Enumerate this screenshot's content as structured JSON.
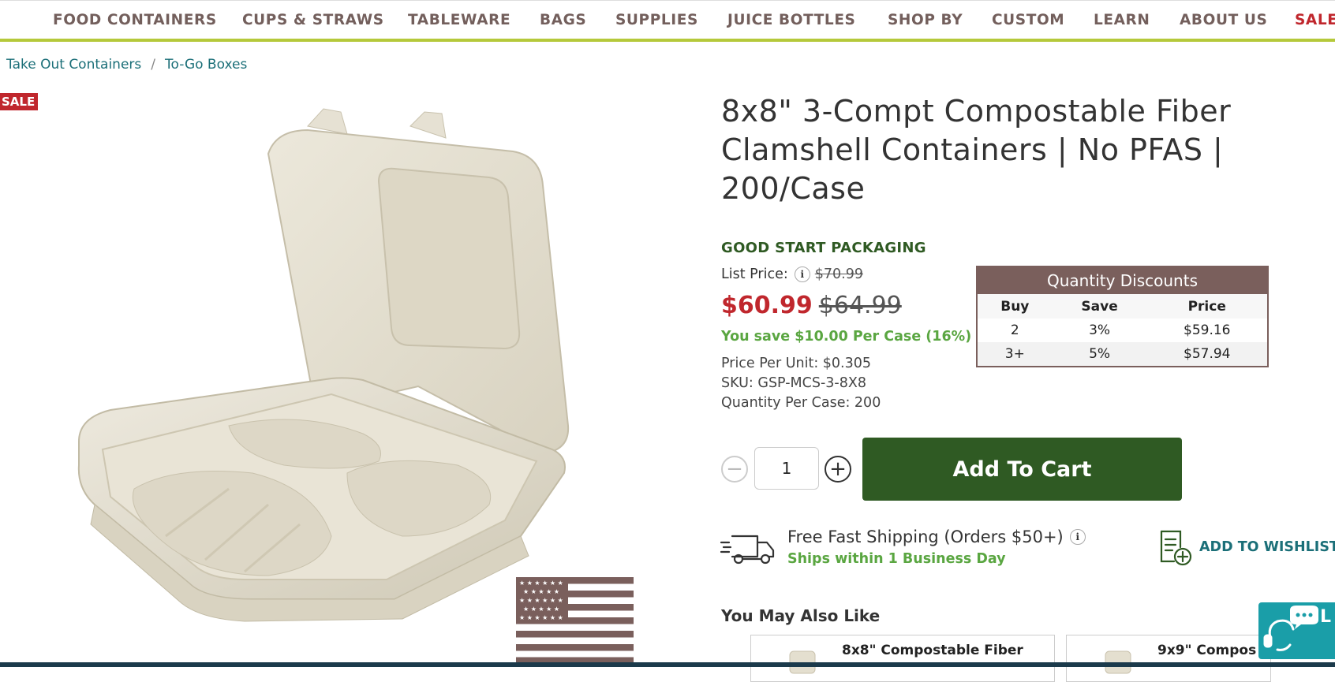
{
  "nav": {
    "items": [
      "FOOD CONTAINERS",
      "CUPS & STRAWS",
      "TABLEWARE",
      "BAGS",
      "SUPPLIES",
      "JUICE BOTTLES",
      "SHOP BY",
      "CUSTOM",
      "LEARN",
      "ABOUT US",
      "SALE"
    ]
  },
  "breadcrumb": {
    "items": [
      "Take Out Containers",
      "To-Go Boxes"
    ],
    "separator": "/"
  },
  "badge": {
    "sale": "SALE"
  },
  "product": {
    "title": "8x8\" 3-Compt Compostable Fiber Clamshell Containers | No PFAS | 200/Case",
    "brand": "GOOD START PACKAGING",
    "list_price_label": "List Price:",
    "list_price": "$70.99",
    "price": "$60.99",
    "old_price": "$64.99",
    "savings": "You save $10.00 Per Case (16%)",
    "price_per_unit": "Price Per Unit: $0.305",
    "sku": "SKU: GSP-MCS-3-8X8",
    "qty_per_case": "Quantity Per Case: 200"
  },
  "discounts": {
    "title": "Quantity Discounts",
    "headers": [
      "Buy",
      "Save",
      "Price"
    ],
    "rows": [
      [
        "2",
        "3%",
        "$59.16"
      ],
      [
        "3+",
        "5%",
        "$57.94"
      ]
    ]
  },
  "cart": {
    "quantity": "1",
    "minus": "−",
    "plus": "+",
    "button": "Add To Cart"
  },
  "shipping": {
    "line1": "Free Fast Shipping (Orders $50+)",
    "line2": "Ships within 1 Business Day",
    "info": "i"
  },
  "wishlist": {
    "label": "ADD TO WISHLIST"
  },
  "also_like": {
    "title": "You May Also Like",
    "items": [
      "8x8\" Compostable Fiber",
      "9x9\" Compos"
    ]
  },
  "chat": {
    "label": "L"
  },
  "colors": {
    "nav_text": "#735f5c",
    "nav_underline": "#b5c93a",
    "sale_red": "#c0272d",
    "brand_green": "#2f5a23",
    "savings_green": "#5aa641",
    "teal": "#1b6f78",
    "table_header": "#7a5f5c",
    "chat_bg": "#1a9ea8"
  },
  "icons": [
    "info-icon",
    "minus-icon",
    "plus-icon",
    "truck-icon",
    "wishlist-icon",
    "chat-icon",
    "flag-icon"
  ]
}
